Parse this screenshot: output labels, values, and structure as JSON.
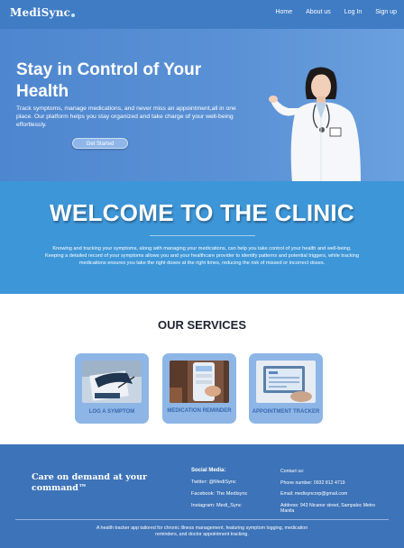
{
  "nav": {
    "logo": "MediSync",
    "links": [
      "Home",
      "About us",
      "Log In",
      "Sign up"
    ]
  },
  "hero": {
    "title": "Stay in Control of Your Health",
    "description": "Track symptoms, manage medications, and never miss an appointment,all in one place. Our platform helps you stay organized and take charge of your well-being effortlessly.",
    "button": "Get Started"
  },
  "welcome": {
    "heading": "WELCOME TO THE CLINIC",
    "text": "Knowing and tracking your symptoms, along with managing your medications, can help you take control of your health and well-being. Keeping a detailed record of your symptoms allows you and your healthcare provider to identify patterns and potential triggers, while tracking medications ensures you take the right doses at the right times, reducing the risk of missed or incorrect doses."
  },
  "services": {
    "heading": "OUR SERVICES",
    "cards": [
      {
        "label": "LOG A SYMPTOM"
      },
      {
        "label": "MEDICATION REMINDER"
      },
      {
        "label": "APPOINTMENT TRACKER"
      }
    ]
  },
  "footer": {
    "tagline": "Care on demand at your command™",
    "social_heading": "Social Media:",
    "social": [
      "Twitter: @MediSync",
      "Facebook:  The Medisync",
      "Instagram: Medi_Sync"
    ],
    "contact_heading": "Contact us:",
    "contact": [
      "Phone number: 0932 812 4719",
      "Email: medisyncorp@gmail.com",
      "Address: 943 Nicanor street, Sampaloc Metro Manila"
    ],
    "bottom_text": "A health tracker app tailored for chronic illness management, featuring symptom logging, medication reminders, and doctor appointment tracking."
  }
}
